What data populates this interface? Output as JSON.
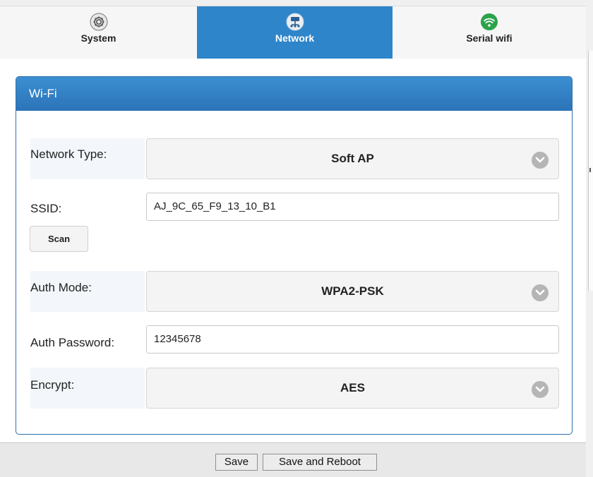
{
  "tabs": [
    {
      "label": "System",
      "icon": "gear-icon",
      "active": false
    },
    {
      "label": "Network",
      "icon": "network-icon",
      "active": true
    },
    {
      "label": "Serial wifi",
      "icon": "wifi-icon",
      "active": false
    }
  ],
  "panel": {
    "title": "Wi-Fi",
    "network_type": {
      "label": "Network Type:",
      "value": "Soft AP"
    },
    "ssid": {
      "label": "SSID:",
      "value": "AJ_9C_65_F9_13_10_B1",
      "scan_label": "Scan"
    },
    "auth_mode": {
      "label": "Auth Mode:",
      "value": "WPA2-PSK"
    },
    "auth_password": {
      "label": "Auth Password:",
      "value": "12345678"
    },
    "encrypt": {
      "label": "Encrypt:",
      "value": "AES"
    }
  },
  "footer": {
    "save_label": "Save",
    "save_reboot_label": "Save and Reboot"
  },
  "colors": {
    "accent": "#2f85c9",
    "panel_border": "#2f6fad"
  }
}
